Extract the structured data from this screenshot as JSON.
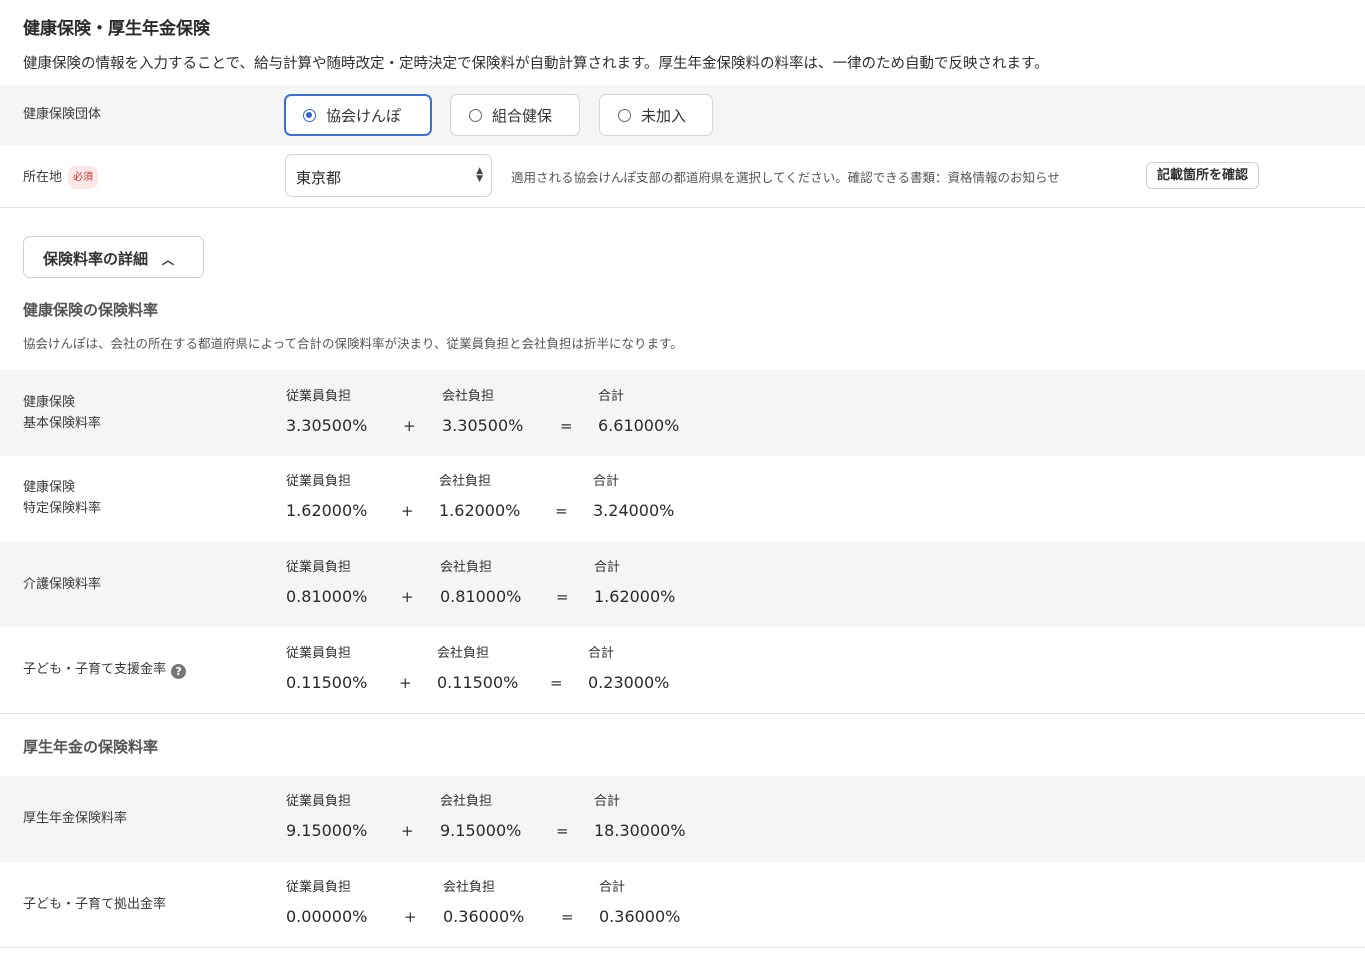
{
  "header": {
    "title": "健康保険・厚生年金保険",
    "description": "健康保険の情報を入力することで、給与計算や随時改定・定時決定で保険料が自動計算されます。厚生年金保険料の料率は、一律のため自動で反映されます。"
  },
  "insurer": {
    "label": "健康保険団体",
    "options": [
      "協会けんぽ",
      "組合健保",
      "未加入"
    ],
    "selected": "協会けんぽ"
  },
  "location": {
    "label": "所在地",
    "required_badge": "必須",
    "value": "東京都",
    "hint": "適用される協会けんぽ支部の都道府県を選択してください。確認できる書類：資格情報のお知らせ",
    "confirm_button": "記載箇所を確認"
  },
  "details_toggle": {
    "label": "保険料率の詳細",
    "expanded": true
  },
  "columns": {
    "employee": "従業員負担",
    "company": "会社負担",
    "total": "合計",
    "plus": "+",
    "equals": "="
  },
  "health_section": {
    "title": "健康保険の保険料率",
    "description": "協会けんぽは、会社の所在する都道府県によって合計の保険料率が決まり、従業員負担と会社負担は折半になります。",
    "rows": [
      {
        "label_line1": "健康保険",
        "label_line2": "基本保険料率",
        "employee": "3.30500%",
        "company": "3.30500%",
        "total": "6.61000%"
      },
      {
        "label_line1": "健康保険",
        "label_line2": "特定保険料率",
        "employee": "1.62000%",
        "company": "1.62000%",
        "total": "3.24000%"
      },
      {
        "label_line1": "介護保険料率",
        "employee": "0.81000%",
        "company": "0.81000%",
        "total": "1.62000%"
      },
      {
        "label_line1": "子ども・子育て支援金率",
        "help_icon": "question-circle-icon",
        "employee": "0.11500%",
        "company": "0.11500%",
        "total": "0.23000%"
      }
    ]
  },
  "pension_section": {
    "title": "厚生年金の保険料率",
    "rows": [
      {
        "label_line1": "厚生年金保険料率",
        "employee": "9.15000%",
        "company": "9.15000%",
        "total": "18.30000%"
      },
      {
        "label_line1": "子ども・子育て拠出金率",
        "employee": "0.00000%",
        "company": "0.36000%",
        "total": "0.36000%"
      }
    ]
  },
  "colors": {
    "accent": "#2f66d6",
    "row_shade": "#f5f5f5",
    "required": "#d0302e"
  }
}
